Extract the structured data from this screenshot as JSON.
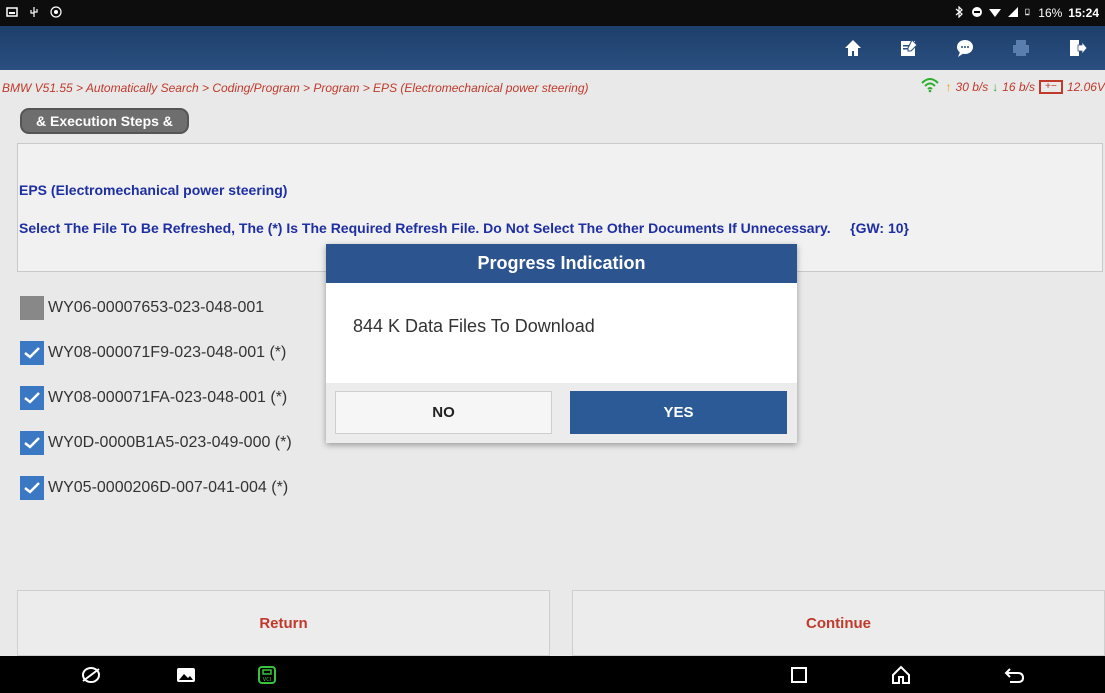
{
  "status_bar": {
    "battery": "16%",
    "time": "15:24"
  },
  "toolbar": {
    "icons": [
      "home-icon",
      "edit-icon",
      "chat-icon",
      "print-icon",
      "exit-icon"
    ]
  },
  "breadcrumb": "BMW V51.55 > Automatically Search > Coding/Program > Program > EPS (Electromechanical power steering)",
  "network": {
    "upload": "30 b/s",
    "download": "16 b/s",
    "voltage": "12.06V"
  },
  "exec_tab": "& Execution Steps &",
  "info": {
    "title": "EPS (Electromechanical power steering)",
    "instruction": "Select The File To Be Refreshed, The (*) Is The Required Refresh File. Do Not Select The Other Documents If Unnecessary.",
    "gw": "{GW: 10}"
  },
  "files": [
    {
      "name": "WY06-00007653-023-048-001",
      "checked": false
    },
    {
      "name": "WY08-000071F9-023-048-001  (*)",
      "checked": true
    },
    {
      "name": "WY08-000071FA-023-048-001  (*)",
      "checked": true
    },
    {
      "name": "WY0D-0000B1A5-023-049-000  (*)",
      "checked": true
    },
    {
      "name": "WY05-0000206D-007-041-004  (*)",
      "checked": true
    }
  ],
  "bottom": {
    "return_label": "Return",
    "continue_label": "Continue"
  },
  "dialog": {
    "title": "Progress Indication",
    "message": "844 K  Data Files To Download",
    "no_label": "NO",
    "yes_label": "YES"
  },
  "colors": {
    "toolbar": "#1d3f6b",
    "dialog_header": "#2c5590",
    "link_red": "#c0392b",
    "info_blue": "#1d2fa3",
    "checkbox_blue": "#3a78c4"
  }
}
